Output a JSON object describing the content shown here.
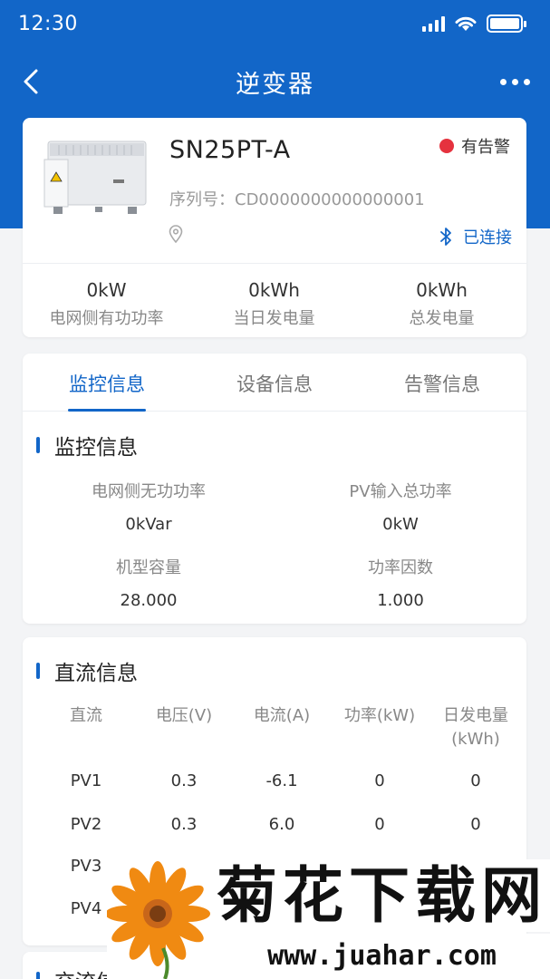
{
  "status_bar": {
    "time": "12:30"
  },
  "nav": {
    "title": "逆变器"
  },
  "device": {
    "model": "SN25PT-A",
    "alarm_label": "有告警",
    "serial_label": "序列号：",
    "serial_value": "CD0000000000000001",
    "connection_label": "已连接",
    "alarm_color": "#e5323e"
  },
  "stats": [
    {
      "value": "0kW",
      "label": "电网侧有功功率"
    },
    {
      "value": "0kWh",
      "label": "当日发电量"
    },
    {
      "value": "0kWh",
      "label": "总发电量"
    }
  ],
  "tabs": [
    {
      "label": "监控信息",
      "active": true
    },
    {
      "label": "设备信息",
      "active": false
    },
    {
      "label": "告警信息",
      "active": false
    }
  ],
  "monitor": {
    "title": "监控信息",
    "items": [
      {
        "label": "电网侧无功功率",
        "value": "0kVar"
      },
      {
        "label": "PV输入总功率",
        "value": "0kW"
      },
      {
        "label": "机型容量",
        "value": "28.000"
      },
      {
        "label": "功率因数",
        "value": "1.000"
      }
    ]
  },
  "dc": {
    "title": "直流信息",
    "headers": [
      "直流",
      "电压(V)",
      "电流(A)",
      "功率(kW)",
      "日发电量",
      "(kWh)"
    ],
    "rows": [
      {
        "name": "PV1",
        "voltage": "0.3",
        "current": "-6.1",
        "power": "0",
        "daily": "0"
      },
      {
        "name": "PV2",
        "voltage": "0.3",
        "current": "6.0",
        "power": "0",
        "daily": "0"
      },
      {
        "name": "PV3"
      },
      {
        "name": "PV4"
      }
    ]
  },
  "ac": {
    "title_partial": "交流信"
  },
  "watermark": {
    "title": "菊花下载网",
    "url": "www.juahar.com"
  },
  "colors": {
    "accent": "#1266c8",
    "background": "#f3f4f6"
  }
}
